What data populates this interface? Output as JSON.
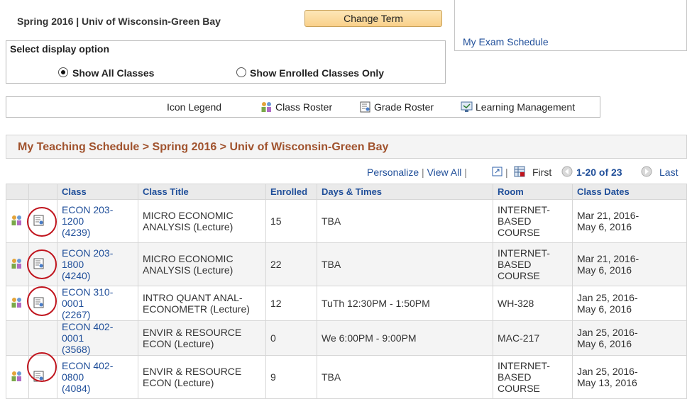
{
  "header": {
    "term_title": "Spring 2016 | Univ of Wisconsin-Green Bay",
    "change_term_label": "Change Term",
    "exam_link": "My Exam Schedule"
  },
  "display_option": {
    "title": "Select display option",
    "options": [
      {
        "label": "Show All Classes",
        "selected": true
      },
      {
        "label": "Show Enrolled Classes Only",
        "selected": false
      }
    ]
  },
  "legend": {
    "title": "Icon Legend",
    "items": [
      {
        "label": "Class Roster",
        "icon": "class-roster-icon"
      },
      {
        "label": "Grade Roster",
        "icon": "grade-roster-icon"
      },
      {
        "label": "Learning Management",
        "icon": "learning-management-icon"
      }
    ]
  },
  "schedule": {
    "title": "My Teaching Schedule > Spring 2016 > Univ of Wisconsin-Green Bay",
    "nav": {
      "personalize": "Personalize",
      "view_all": "View All",
      "first": "First",
      "range": "1-20 of 23",
      "last": "Last"
    },
    "columns": [
      "Class",
      "Class Title",
      "Enrolled",
      "Days & Times",
      "Room",
      "Class Dates"
    ],
    "rows": [
      {
        "class1": "ECON 203-1200",
        "class2": "(4239)",
        "title1": "MICRO ECONOMIC",
        "title2": "ANALYSIS (Lecture)",
        "enrolled": "15",
        "days": "TBA",
        "room1": "INTERNET-",
        "room2": "BASED",
        "room3": "COURSE",
        "dates1": "Mar 21, 2016-",
        "dates2": "May 6, 2016"
      },
      {
        "class1": "ECON 203-1800",
        "class2": "(4240)",
        "title1": "MICRO ECONOMIC",
        "title2": "ANALYSIS (Lecture)",
        "enrolled": "22",
        "days": "TBA",
        "room1": "INTERNET-",
        "room2": "BASED",
        "room3": "COURSE",
        "dates1": "Mar 21, 2016-",
        "dates2": "May 6, 2016"
      },
      {
        "class1": "ECON 310-0001",
        "class2": "(2267)",
        "title1": "INTRO QUANT ANAL-",
        "title2": "ECONOMETR (Lecture)",
        "enrolled": "12",
        "days": "TuTh 12:30PM - 1:50PM",
        "room1": "WH-328",
        "room2": "",
        "room3": "",
        "dates1": "Jan 25, 2016-",
        "dates2": "May 6, 2016"
      },
      {
        "class1": "ECON 402-0001",
        "class2": "(3568)",
        "title1": "ENVIR & RESOURCE",
        "title2": "ECON (Lecture)",
        "enrolled": "0",
        "days": "We 6:00PM - 9:00PM",
        "room1": "MAC-217",
        "room2": "",
        "room3": "",
        "dates1": "Jan 25, 2016-",
        "dates2": "May 6, 2016"
      },
      {
        "class1": "ECON 402-0800",
        "class2": "(4084)",
        "title1": "ENVIR & RESOURCE",
        "title2": "ECON (Lecture)",
        "enrolled": "9",
        "days": "TBA",
        "room1": "INTERNET-",
        "room2": "BASED",
        "room3": "COURSE",
        "dates1": "Jan 25, 2016-",
        "dates2": "May 13, 2016"
      }
    ]
  },
  "colors": {
    "link": "#1f4e99",
    "section_title": "#a0522d",
    "button_bg": "#f9d08a",
    "annotation_circle": "#c0151e"
  }
}
